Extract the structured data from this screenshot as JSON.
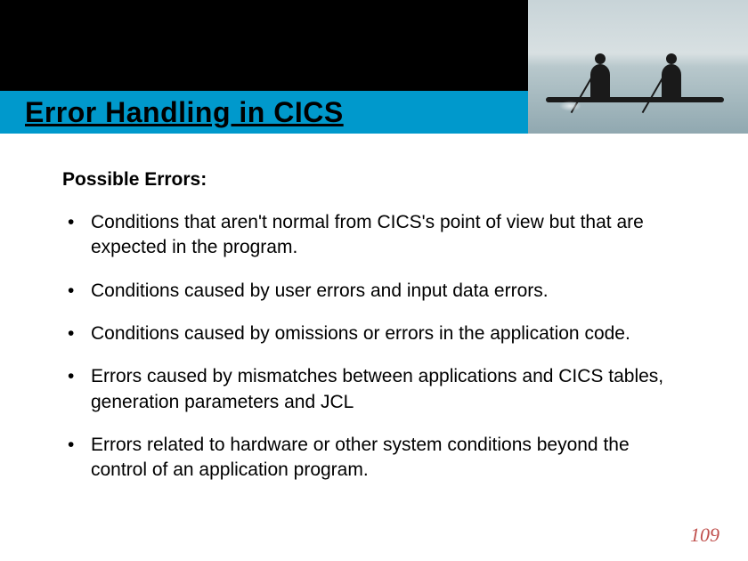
{
  "slide": {
    "title": "Error Handling in CICS",
    "subtitle": "Possible Errors:",
    "bullets": [
      "Conditions that aren't normal from CICS's point of view but that are expected in the program.",
      "Conditions caused by user errors and input data errors.",
      "Conditions caused by omissions or errors in the application code.",
      "Errors caused by mismatches between applications and CICS tables, generation parameters and JCL",
      "Errors related to hardware or other system conditions beyond the control of an application program."
    ],
    "page_number": "109"
  },
  "colors": {
    "header_accent": "#0099cc",
    "page_number": "#c0504d"
  }
}
